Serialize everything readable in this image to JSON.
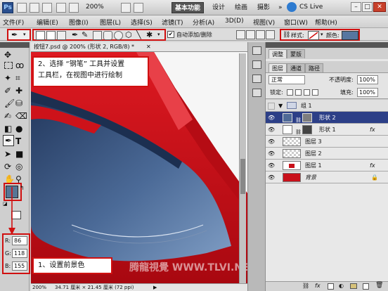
{
  "app": {
    "logo": "Ps",
    "zoom": "200%",
    "cs_live": "CS Live"
  },
  "menu": [
    "文件(F)",
    "编辑(E)",
    "图像(I)",
    "图层(L)",
    "选择(S)",
    "滤镜(T)",
    "分析(A)",
    "3D(D)",
    "视图(V)",
    "窗口(W)",
    "帮助(H)"
  ],
  "workspaces": [
    "基本功能",
    "设计",
    "绘画",
    "摄影"
  ],
  "workspace_more": "»",
  "options": {
    "auto_add_delete": "自动添加/删除",
    "style_label": "样式:",
    "color_label": "颜色:",
    "color_value": "#5676a0"
  },
  "document": {
    "tab": "按钮7.psd @ 200% (形状 2, RGB/8) *",
    "zoom": "200%",
    "doc_info": "34.71 厘米 × 21.45 厘米 (72 ppi)"
  },
  "callouts": {
    "pen_tip_line1": "2、选择 “钢笔” 工具并设置",
    "pen_tip_line2": "工具栏，在视图中进行绘制",
    "fg_tip": "1、设置前景色"
  },
  "colors": {
    "foreground": "#567696",
    "r": "86",
    "g": "118",
    "b": "155",
    "r_label": "R:",
    "g_label": "G:",
    "b_label": "B:"
  },
  "panel": {
    "top_tabs": [
      "调整",
      "蒙版"
    ],
    "layer_tabs": [
      "图层",
      "通道",
      "路径"
    ],
    "blend_mode": "正常",
    "opacity_label": "不透明度:",
    "opacity": "100%",
    "lock_label": "锁定:",
    "fill_label": "填充:",
    "fill": "100%",
    "layers": [
      {
        "name": "组 1",
        "type": "group"
      },
      {
        "name": "形状 2",
        "type": "shape",
        "selected": true
      },
      {
        "name": "形状 1",
        "type": "shape",
        "fx": "fx"
      },
      {
        "name": "图层 3",
        "type": "layer"
      },
      {
        "name": "图层 2",
        "type": "layer"
      },
      {
        "name": "图层 1",
        "type": "layer",
        "fx": "fx"
      },
      {
        "name": "背景",
        "type": "background"
      }
    ]
  },
  "watermark": "腾龍視覺 WWW.TLVI.NET"
}
